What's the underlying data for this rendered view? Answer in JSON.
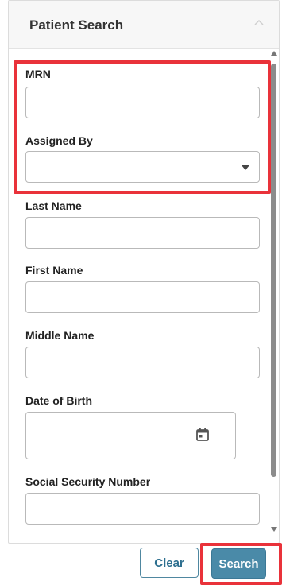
{
  "panel": {
    "title": "Patient Search"
  },
  "fields": {
    "mrn": {
      "label": "MRN",
      "value": ""
    },
    "assigned_by": {
      "label": "Assigned By",
      "selected": ""
    },
    "last_name": {
      "label": "Last Name",
      "value": ""
    },
    "first_name": {
      "label": "First Name",
      "value": ""
    },
    "middle_name": {
      "label": "Middle Name",
      "value": ""
    },
    "dob": {
      "label": "Date of Birth",
      "value": ""
    },
    "ssn": {
      "label": "Social Security Number",
      "value": ""
    }
  },
  "buttons": {
    "clear": "Clear",
    "search": "Search"
  },
  "colors": {
    "highlight": "#e9323a",
    "primary_button": "#4a8aa8"
  },
  "icons": {
    "collapse": "chevron-up-icon",
    "dropdown": "chevron-down-icon",
    "calendar": "calendar-icon"
  }
}
